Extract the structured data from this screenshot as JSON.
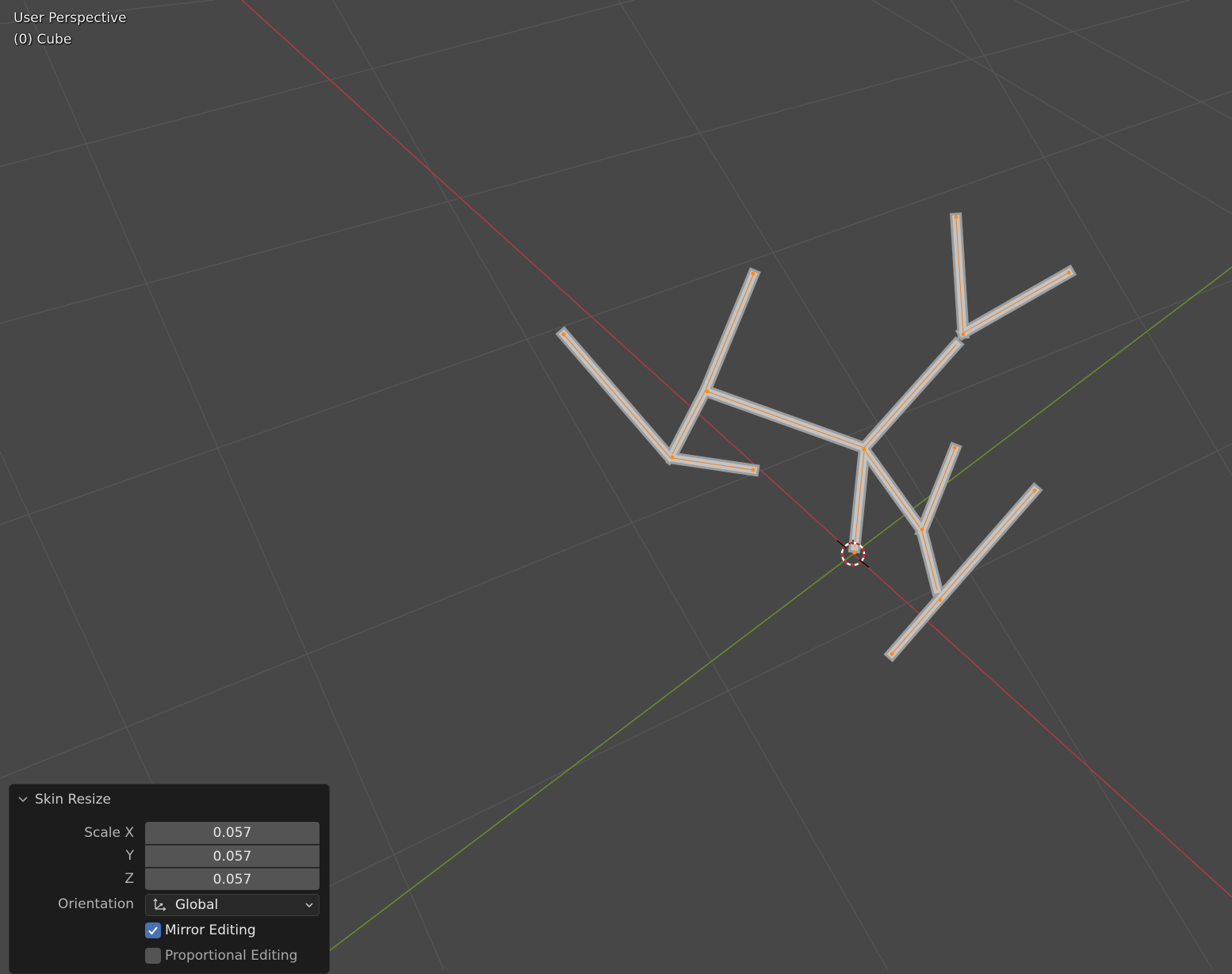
{
  "viewport": {
    "view_name": "User Perspective",
    "object_info": "(0) Cube",
    "colors": {
      "background": "#474747",
      "grid": "#555555",
      "x_axis": "#a83a43",
      "y_axis": "#6a8a2a",
      "mesh": "#b9b9b9",
      "mesh_edge": "#f08020",
      "selected_vertex": "#ff8c1a"
    },
    "icons": [
      "3d-cursor-icon"
    ]
  },
  "operator_panel": {
    "title": "Skin Resize",
    "scale_label": "Scale X",
    "y_label": "Y",
    "z_label": "Z",
    "scale_x": "0.057",
    "scale_y": "0.057",
    "scale_z": "0.057",
    "orientation_label": "Orientation",
    "orientation_value": "Global",
    "mirror_editing_label": "Mirror Editing",
    "mirror_editing_checked": true,
    "proportional_editing_label": "Proportional Editing",
    "proportional_editing_checked": false,
    "icons": [
      "chevron-down-icon",
      "orientation-axes-icon",
      "dropdown-arrow-icon",
      "checkmark-icon"
    ]
  }
}
